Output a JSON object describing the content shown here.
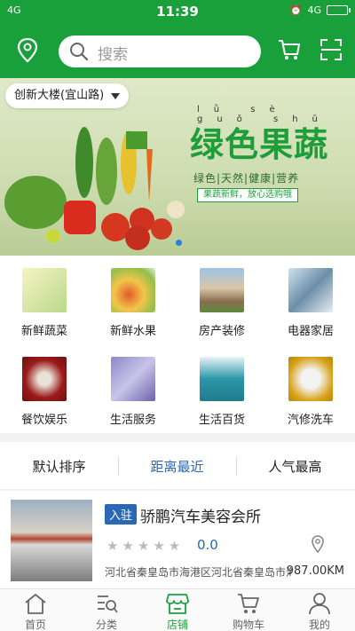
{
  "status_bar": {
    "network_left": "4G",
    "time": "11:39",
    "network_right": "4G"
  },
  "header": {
    "search_placeholder": "搜索"
  },
  "banner": {
    "location": "创新大楼(宜山路)",
    "title": "绿色果蔬",
    "pinyin": "lǜ sè guǒ shū",
    "subtitle": "绿色|天然|健康|营养",
    "tagline": "果蔬新鲜，放心选购哦"
  },
  "categories": [
    {
      "label": "新鲜蔬菜",
      "icon": "vegetables-icon"
    },
    {
      "label": "新鲜水果",
      "icon": "fruit-icon"
    },
    {
      "label": "房产装修",
      "icon": "real-estate-icon"
    },
    {
      "label": "电器家居",
      "icon": "appliances-icon"
    },
    {
      "label": "餐饮娱乐",
      "icon": "dining-icon"
    },
    {
      "label": "生活服务",
      "icon": "life-service-icon"
    },
    {
      "label": "生活百货",
      "icon": "goods-icon"
    },
    {
      "label": "汽修洗车",
      "icon": "car-wash-icon"
    }
  ],
  "sort_options": [
    {
      "label": "默认排序",
      "active": false
    },
    {
      "label": "距离最近",
      "active": true
    },
    {
      "label": "人气最高",
      "active": false
    }
  ],
  "store": {
    "badge": "入驻",
    "name": "骄鹏汽车美容会所",
    "stars": "★★★★★",
    "rating": "0.0",
    "address": "河北省秦皇岛市海港区河北省秦皇岛市海港区",
    "distance": "987.00KM"
  },
  "bottom_nav": [
    {
      "label": "首页",
      "icon": "home-icon",
      "active": false
    },
    {
      "label": "分类",
      "icon": "category-icon",
      "active": false
    },
    {
      "label": "店铺",
      "icon": "shop-icon",
      "active": true
    },
    {
      "label": "购物车",
      "icon": "cart-icon",
      "active": false
    },
    {
      "label": "我的",
      "icon": "profile-icon",
      "active": false
    }
  ],
  "colors": {
    "brand_green": "#1aa03a",
    "accent_blue": "#2a67b4"
  }
}
